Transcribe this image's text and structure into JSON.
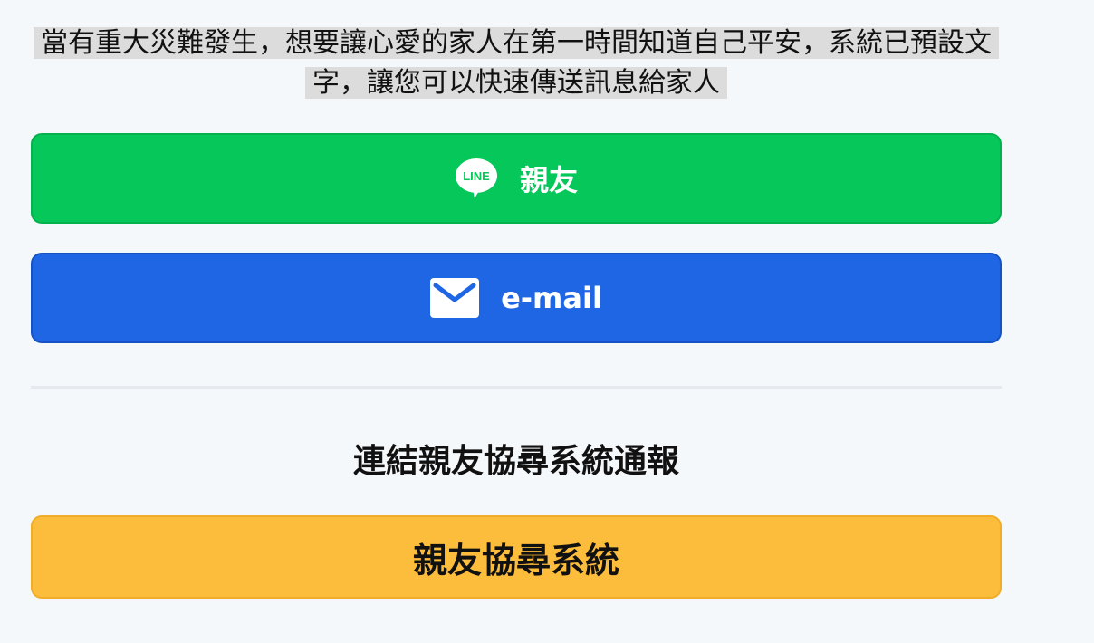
{
  "intro_text": "當有重大災難發生，想要讓心愛的家人在第一時間知道自己平安，系統已預設文字，讓您可以快速傳送訊息給家人",
  "buttons": {
    "line": {
      "icon": "line-icon",
      "icon_text": "LINE",
      "label": "親友",
      "color": "#06c75a"
    },
    "email": {
      "icon": "mail-icon",
      "label": "e-mail",
      "color": "#1f66e5"
    },
    "family_system": {
      "label": "親友協尋系統",
      "color": "#fdbd3c"
    }
  },
  "section_title": "連結親友協尋系統通報"
}
